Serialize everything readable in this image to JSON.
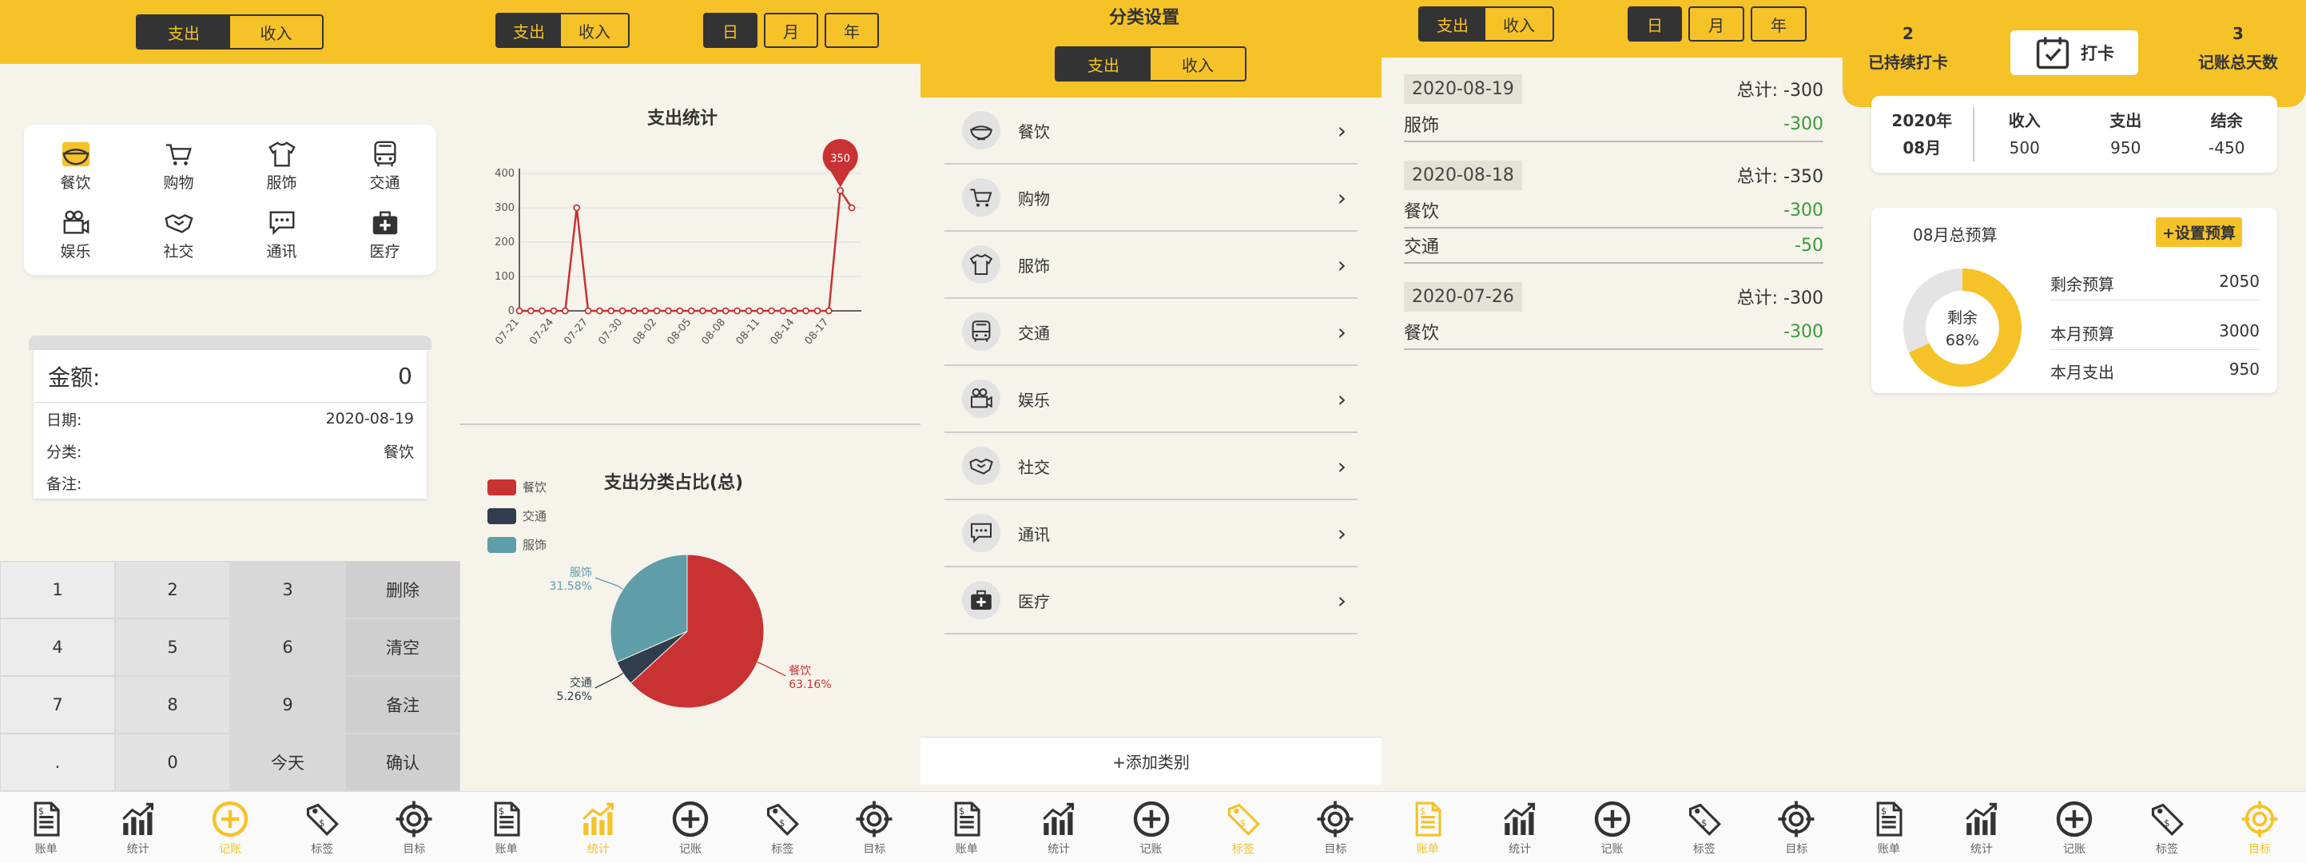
{
  "colors": {
    "accent": "#f5c228",
    "dark": "#333333",
    "red": "#c83232",
    "navy": "#2f3d4c",
    "teal": "#5f9ea8",
    "green": "#3a9a3a"
  },
  "nav": [
    {
      "label": "账单",
      "icon": "bill-icon"
    },
    {
      "label": "统计",
      "icon": "chart-icon"
    },
    {
      "label": "记账",
      "icon": "add-circle-icon"
    },
    {
      "label": "标签",
      "icon": "tag-icon"
    },
    {
      "label": "目标",
      "icon": "target-icon"
    }
  ],
  "type_tabs": {
    "expense": "支出",
    "income": "收入"
  },
  "period_tabs": {
    "day": "日",
    "month": "月",
    "year": "年"
  },
  "categories": [
    {
      "label": "餐饮",
      "icon": "rice-bowl-icon"
    },
    {
      "label": "购物",
      "icon": "cart-icon"
    },
    {
      "label": "服饰",
      "icon": "shirt-icon"
    },
    {
      "label": "交通",
      "icon": "bus-icon"
    },
    {
      "label": "娱乐",
      "icon": "camera-icon"
    },
    {
      "label": "社交",
      "icon": "handshake-icon"
    },
    {
      "label": "通讯",
      "icon": "chat-icon"
    },
    {
      "label": "医疗",
      "icon": "medkit-icon"
    }
  ],
  "record": {
    "amount_label": "金额:",
    "amount_value": "0",
    "date_label": "日期:",
    "date_value": "2020-08-19",
    "category_label": "分类:",
    "category_value": "餐饮",
    "note_label": "备注:",
    "note_value": ""
  },
  "keypad": [
    "1",
    "2",
    "3",
    "删除",
    "4",
    "5",
    "6",
    "清空",
    "7",
    "8",
    "9",
    "备注",
    ".",
    "0",
    "今天",
    "确认"
  ],
  "stats": {
    "line_title": "支出统计",
    "pie_title": "支出分类占比(总)"
  },
  "chart_data": [
    {
      "type": "line",
      "title": "支出统计",
      "x": [
        "07-21",
        "07-22",
        "07-23",
        "07-24",
        "07-25",
        "07-26",
        "07-27",
        "07-28",
        "07-29",
        "07-30",
        "07-31",
        "08-01",
        "08-02",
        "08-03",
        "08-04",
        "08-05",
        "08-06",
        "08-07",
        "08-08",
        "08-09",
        "08-10",
        "08-11",
        "08-12",
        "08-13",
        "08-14",
        "08-15",
        "08-16",
        "08-17",
        "08-18",
        "08-19"
      ],
      "tick_labels": [
        "07-21",
        "07-24",
        "07-27",
        "07-30",
        "08-02",
        "08-05",
        "08-08",
        "08-11",
        "08-14",
        "08-17"
      ],
      "values": [
        0,
        0,
        0,
        0,
        0,
        300,
        0,
        0,
        0,
        0,
        0,
        0,
        0,
        0,
        0,
        0,
        0,
        0,
        0,
        0,
        0,
        0,
        0,
        0,
        0,
        0,
        0,
        0,
        350,
        300
      ],
      "yticks": [
        0,
        100,
        200,
        300,
        400
      ],
      "ylim": [
        0,
        400
      ],
      "marker": {
        "label": "350"
      }
    },
    {
      "type": "pie",
      "title": "支出分类占比(总)",
      "slices": [
        {
          "name": "餐饮",
          "value": 63.16,
          "label": "63.16%",
          "color": "#c83232"
        },
        {
          "name": "交通",
          "value": 5.26,
          "label": "5.26%",
          "color": "#2f3d4c"
        },
        {
          "name": "服饰",
          "value": 31.58,
          "label": "31.58%",
          "color": "#5f9ea8"
        }
      ],
      "legend": "top-left"
    }
  ],
  "category_settings": {
    "title": "分类设置",
    "add_label": "+添加类别"
  },
  "bills": [
    {
      "date": "2020-08-19",
      "total": "总计: -300",
      "items": [
        {
          "name": "服饰",
          "amount": "-300"
        }
      ]
    },
    {
      "date": "2020-08-18",
      "total": "总计: -350",
      "items": [
        {
          "name": "餐饮",
          "amount": "-300"
        },
        {
          "name": "交通",
          "amount": "-50"
        }
      ]
    },
    {
      "date": "2020-07-26",
      "total": "总计: -300",
      "items": [
        {
          "name": "餐饮",
          "amount": "-300"
        }
      ]
    }
  ],
  "goals": {
    "streak_num": "2",
    "streak_label": "已持续打卡",
    "checkin_label": "打卡",
    "days_num": "3",
    "days_label": "记账总天数",
    "year": "2020年",
    "month": "08月",
    "income_label": "收入",
    "income_value": "500",
    "expense_label": "支出",
    "expense_value": "950",
    "balance_label": "结余",
    "balance_value": "-450",
    "budget_title": "08月总预算",
    "set_budget": "+设置预算",
    "ring_label": "剩余",
    "ring_percent": "68%",
    "ring_fraction": 0.68,
    "remain_label": "剩余预算",
    "remain_value": "2050",
    "month_budget_label": "本月预算",
    "month_budget_value": "3000",
    "month_expense_label": "本月支出",
    "month_expense_value": "950"
  }
}
